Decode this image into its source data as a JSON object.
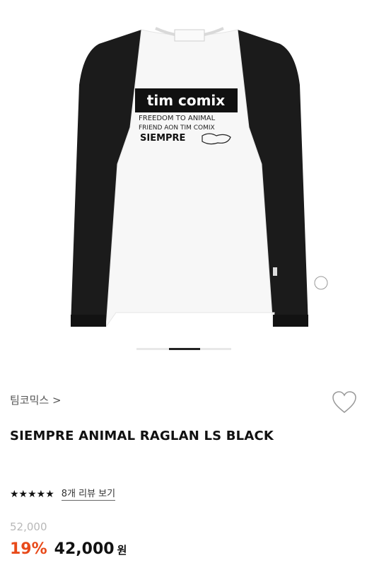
{
  "product_image": {
    "print_logo": "tim comix",
    "print_line1": "FREEDOM TO ANIMAL",
    "print_line2": "FRIEND AON TIM COMIX",
    "print_line3": "SIEMPRE",
    "shirt_body_color": "#f7f7f7",
    "shirt_sleeve_color": "#1b1b1b"
  },
  "carousel": {
    "active_index": 1,
    "count": 3
  },
  "brand": {
    "name": "팀코믹스 >"
  },
  "product": {
    "title": "SIEMPRE ANIMAL RAGLAN LS BLACK"
  },
  "rating": {
    "stars": "★★★★★",
    "reviews_label": "8개 리뷰 보기"
  },
  "pricing": {
    "original_price": "52,000",
    "discount": "19%",
    "sale_price": "42,000",
    "currency": "원",
    "discount_color": "#e84a1a"
  },
  "icons": {
    "favorite": "heart-outline-icon"
  }
}
